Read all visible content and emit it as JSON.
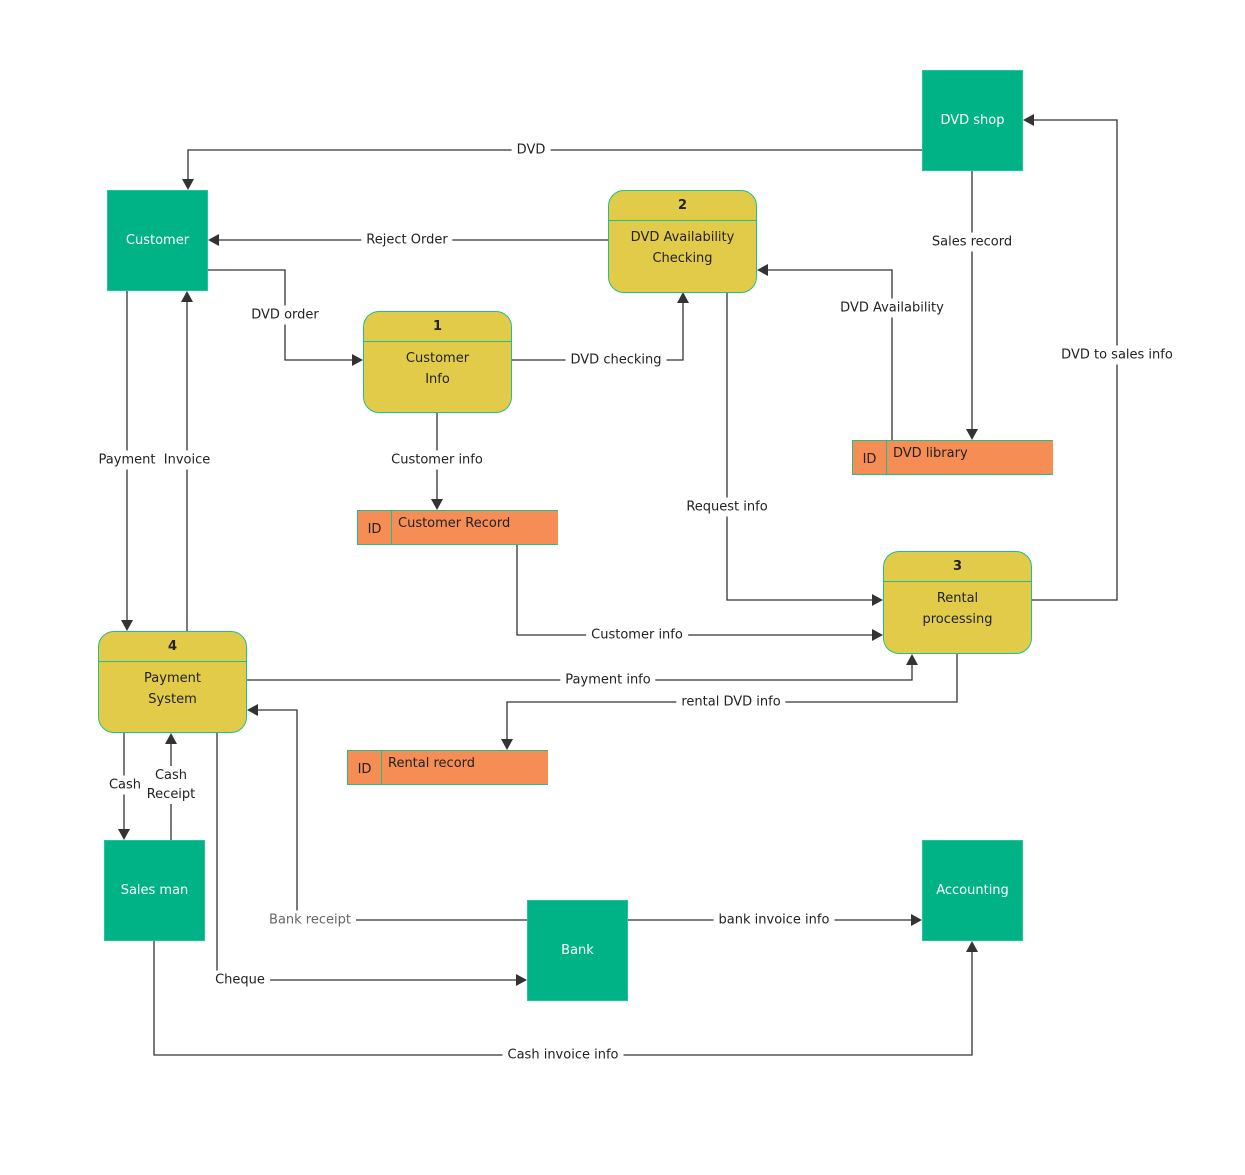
{
  "colors": {
    "entity": "#00b386",
    "process": "#e3cb4a",
    "store": "#f58d55",
    "border": "#1fbf8f",
    "line": "#333333"
  },
  "entities": {
    "dvd_shop": "DVD shop",
    "customer": "Customer",
    "salesman": "Sales man",
    "bank": "Bank",
    "accounting": "Accounting"
  },
  "processes": [
    {
      "num": "1",
      "name": "Customer\nInfo"
    },
    {
      "num": "2",
      "name": "DVD Availability\nChecking"
    },
    {
      "num": "3",
      "name": "Rental\nprocessing"
    },
    {
      "num": "4",
      "name": "Payment\nSystem"
    }
  ],
  "stores": [
    {
      "id": "ID",
      "name": "Customer Record"
    },
    {
      "id": "ID",
      "name": "DVD library"
    },
    {
      "id": "ID",
      "name": "Rental record"
    }
  ],
  "flows": [
    "DVD",
    "Reject Order",
    "DVD order",
    "DVD checking",
    "DVD Availability",
    "Sales record",
    "DVD to sales info",
    "Customer info",
    "Request info",
    "Customer info",
    "Payment info",
    "rental DVD info",
    "Payment",
    "Invoice",
    "Cash",
    "Cash\nReceipt",
    "Bank receipt",
    "Cheque",
    "bank invoice info",
    "Cash invoice info"
  ]
}
